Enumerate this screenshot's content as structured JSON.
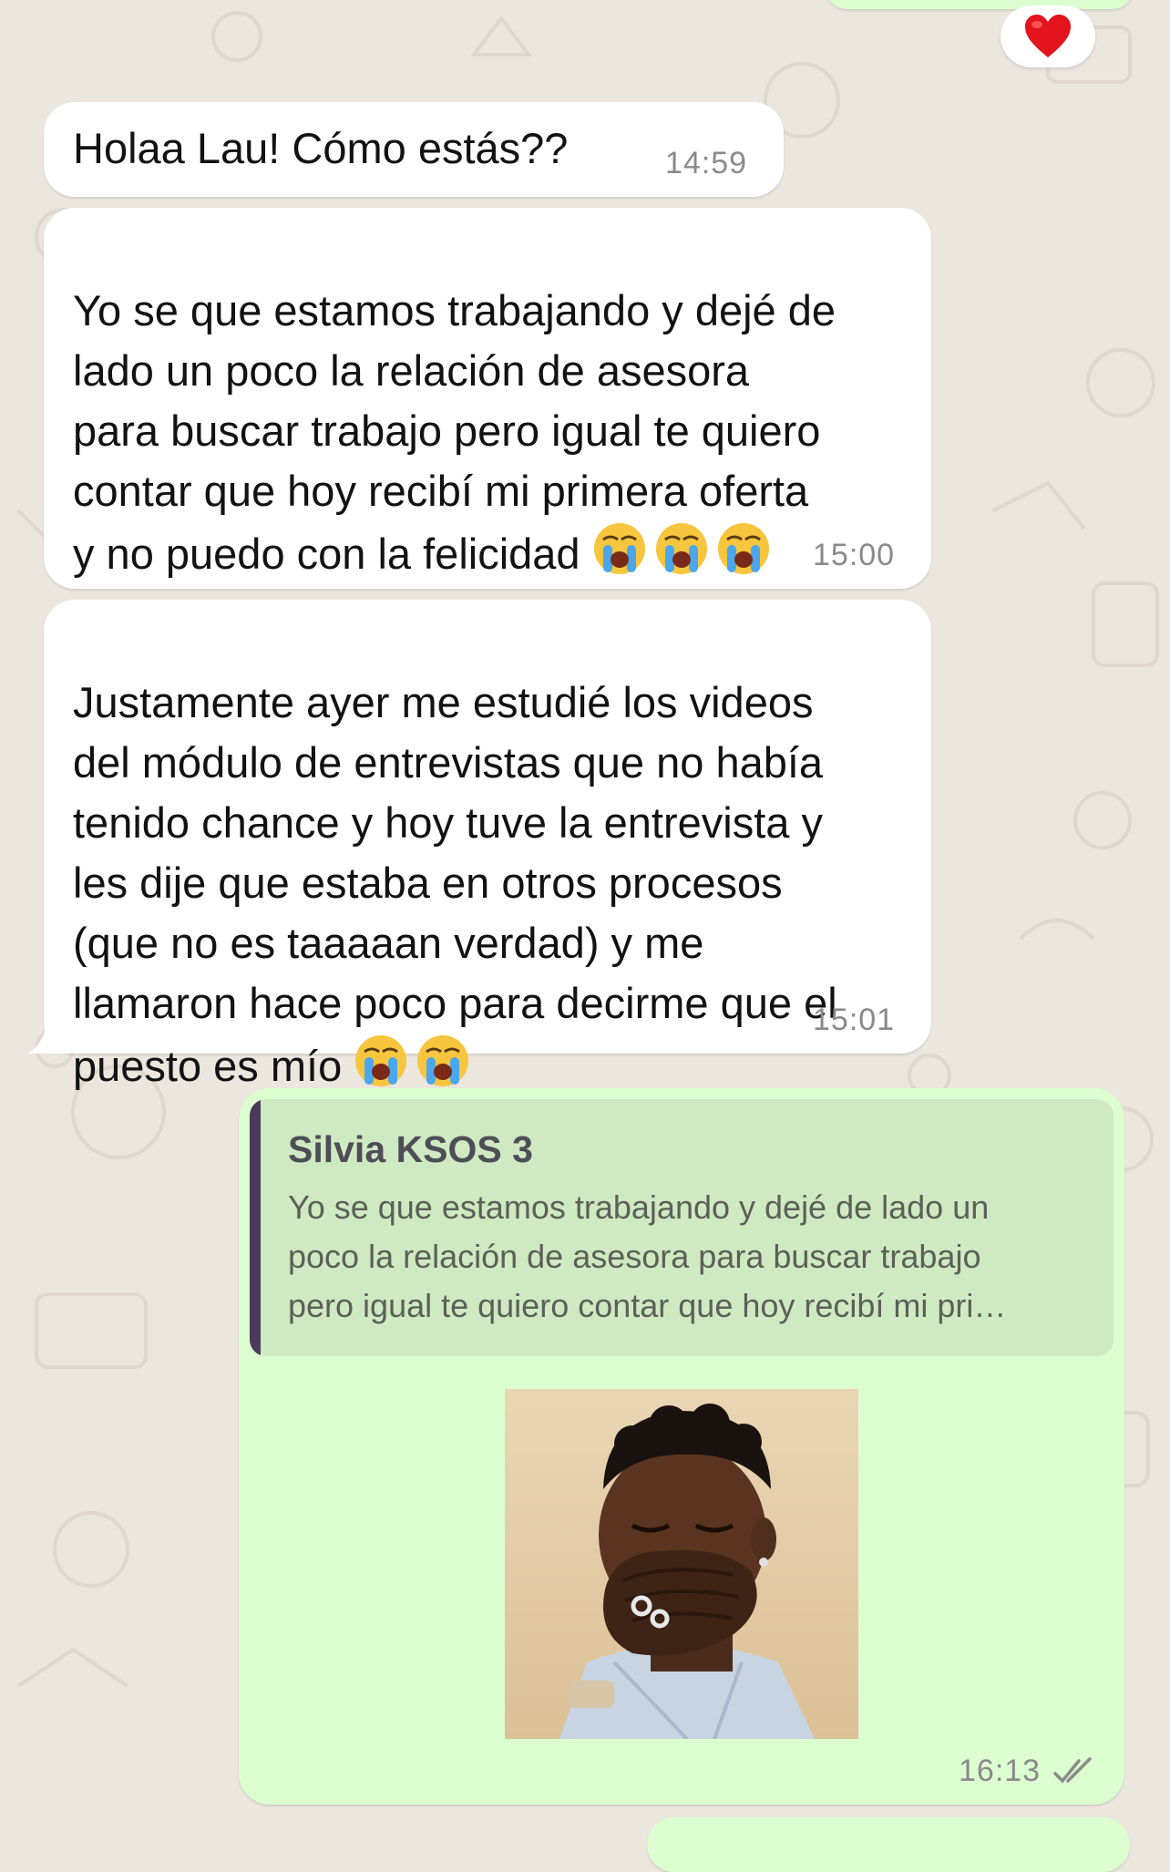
{
  "colors": {
    "incoming_bubble": "#ffffff",
    "outgoing_bubble": "#dcfdcf",
    "quote_bar": "#4a3b5a",
    "wallpaper": "#ebe6de"
  },
  "reaction": {
    "emoji": "red-heart-icon"
  },
  "messages": [
    {
      "text": "Holaa Lau! Cómo estás??",
      "time": "14:59"
    },
    {
      "text": "Yo se que estamos trabajando y dejé de\nlado un poco la relación de asesora\npara buscar trabajo pero igual te quiero\ncontar que hoy recibí mi primera oferta\ny no puedo con la felicidad",
      "emojis": [
        "loudly-crying-face-icon",
        "loudly-crying-face-icon",
        "loudly-crying-face-icon"
      ],
      "time": "15:00"
    },
    {
      "text": "Justamente ayer me estudié los videos\ndel módulo de entrevistas que no había\ntenido chance y hoy tuve la entrevista y\nles dije que estaba en otros procesos\n(que no es taaaaan verdad) y me\nllamaron hace poco para decirme que el\npuesto es mío",
      "emojis": [
        "loudly-crying-face-icon",
        "loudly-crying-face-icon"
      ],
      "time": "15:01"
    }
  ],
  "reply": {
    "quoted_author": "Silvia KSOS 3",
    "quoted_text": "Yo se que estamos trabajando y dejé de lado un\npoco la relación de asesora para buscar trabajo\npero igual te quiero contar que hoy recibí mi pri…",
    "media": "photo-sticker-man-crying-covering-mouth",
    "time": "16:13",
    "status": "double-check-read-icon"
  }
}
